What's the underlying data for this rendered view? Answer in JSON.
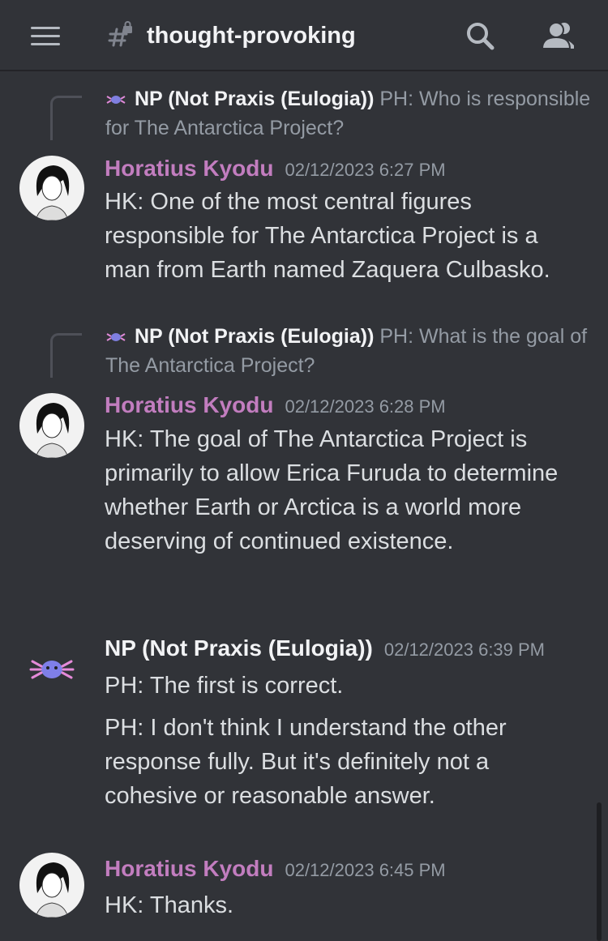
{
  "header": {
    "channel_name": "thought-provoking",
    "menu_icon": "hamburger-menu-icon",
    "channel_icon": "locked-hash-icon",
    "search_icon": "search-icon",
    "members_icon": "members-icon"
  },
  "messages": [
    {
      "reply": {
        "author": "NP (Not Praxis (Eulogia))",
        "text": "PH: Who is responsible for The Antarctica Project?"
      },
      "author": "Horatius Kyodu",
      "timestamp": "02/12/2023 6:27 PM",
      "lines": [
        "HK: One of the most central figures responsible for The Antarctica Project is a man from Earth named Zaquera Culbasko."
      ]
    },
    {
      "reply": {
        "author": "NP (Not Praxis (Eulogia))",
        "text": "PH: What is the goal of The Antarctica Project?"
      },
      "author": "Horatius Kyodu",
      "timestamp": "02/12/2023 6:28 PM",
      "lines": [
        "HK: The goal of The Antarctica Project is primarily to allow Erica Furuda to determine whether Earth or Arctica is a world more deserving of continued existence."
      ]
    },
    {
      "author": "NP (Not Praxis (Eulogia))",
      "timestamp": "02/12/2023 6:39 PM",
      "lines": [
        "PH: The first is correct.",
        "PH: I don't think I understand the other response fully. But it's definitely not a cohesive or reasonable answer."
      ]
    },
    {
      "author": "Horatius Kyodu",
      "timestamp": "02/12/2023 6:45 PM",
      "lines": [
        "HK: Thanks."
      ]
    }
  ],
  "colors": {
    "background": "#313338",
    "hk_name": "#c27dbf",
    "timestamp": "#949ba4",
    "text": "#dbdee1"
  }
}
